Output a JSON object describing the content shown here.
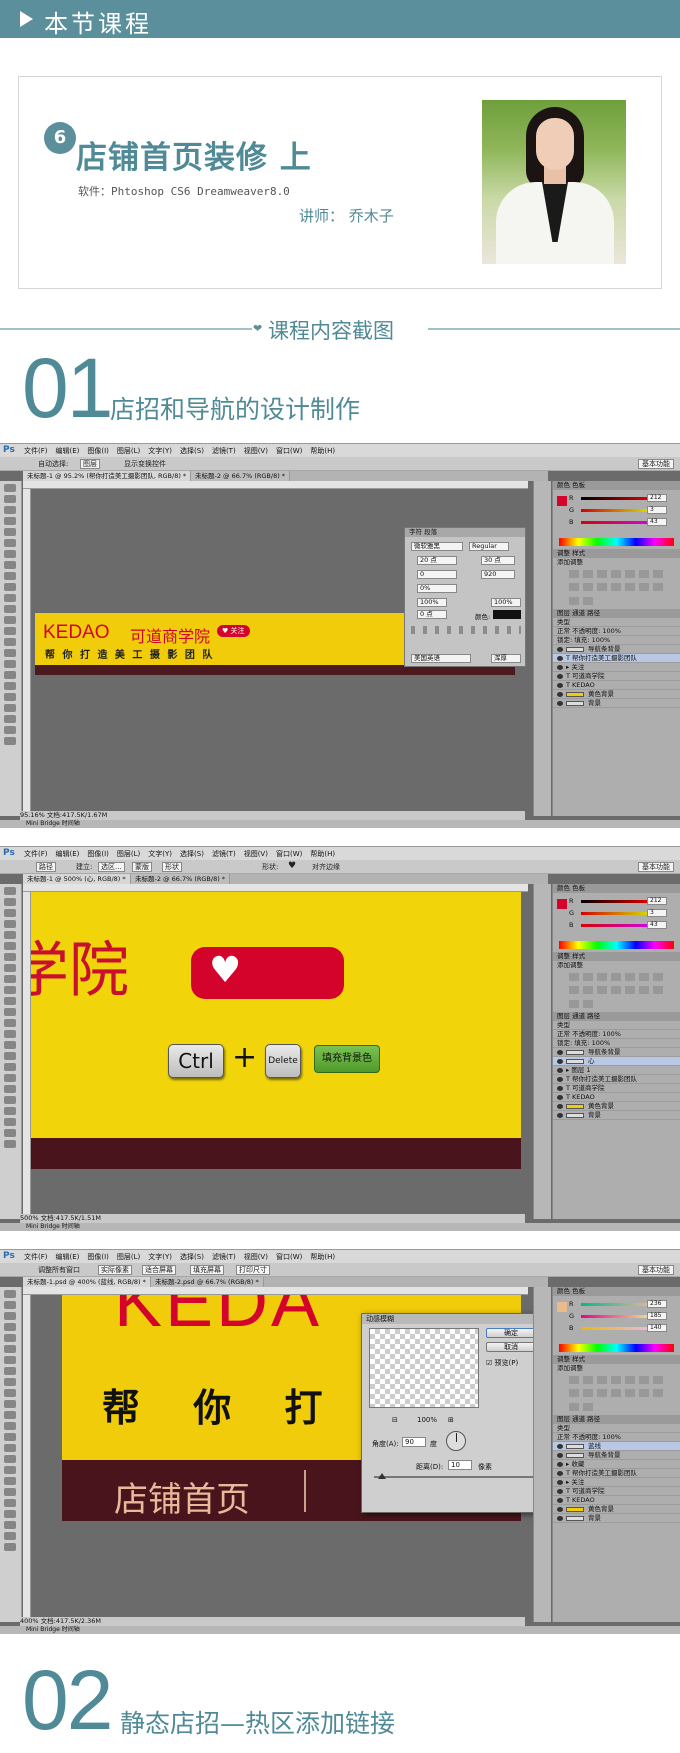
{
  "header": {
    "title": "本节课程"
  },
  "course": {
    "number": "6",
    "title": "店铺首页装修 上",
    "software": "软件：Phtoshop CS6 Dreamweaver8.0",
    "lecturer": "讲师：  乔木子"
  },
  "section_header": {
    "title": "课程内容截图"
  },
  "sections": [
    {
      "number": "01",
      "title": "店招和导航的设计制作"
    },
    {
      "number": "02",
      "title": "静态店招—热区添加链接"
    }
  ],
  "photoshop": {
    "logo": "Ps",
    "menu": [
      "文件(F)",
      "编辑(E)",
      "图像(I)",
      "图层(L)",
      "文字(Y)",
      "选择(S)",
      "滤镜(T)",
      "视图(V)",
      "窗口(W)",
      "帮助(H)"
    ],
    "workspace": "基本功能",
    "mini_bridge": "Mini Bridge",
    "timeline": "时间轴",
    "panel_tabs": {
      "color": "颜色",
      "swatches": "色板",
      "adjust": "调整",
      "styles": "样式",
      "layers": "图层",
      "channels": "通道",
      "paths": "路径"
    },
    "add_adjust": "添加调整",
    "rgb": [
      "R",
      "G",
      "B"
    ],
    "layer_kind": "类型",
    "blend": "正常",
    "opacity_label": "不透明度:",
    "fill_label": "填充:",
    "lock_label": "锁定:",
    "percent": "100%"
  },
  "shot1": {
    "options": {
      "auto_select": "自动选择:",
      "group": "图层",
      "show_transform": "显示变换控件"
    },
    "tabs": [
      "未标题-1 @ 95.2% (帮你打造美工摄影团队, RGB/8) *",
      "未标题-2 @ 66.7% (RGB/8) *"
    ],
    "zoom": "95.16%",
    "doc": "文档:417.5K/1.67M",
    "banner_brand": "KEDAO",
    "banner_cn": "可道商学院",
    "follow": "关注",
    "banner_sub": "帮 你 打 造 美 工 摄 影 团 队",
    "char_panel": {
      "tab1": "字符",
      "tab2": "段落",
      "font": "微软雅黑",
      "style": "Regular",
      "size": "20 点",
      "leading": "30 点",
      "tracking": "920",
      "kerning": "0",
      "scale_h": "100%",
      "scale_v": "100%",
      "shift": "0 点",
      "pct": "0%",
      "color_label": "颜色:",
      "lang": "美国英语",
      "aa": "浑厚"
    },
    "rgb_values": [
      "212",
      "3",
      "43"
    ],
    "layers": [
      "导航条背景",
      "帮你打造美工摄影团队",
      "关注",
      "可道商学院",
      "KEDAO",
      "黄色背景",
      "背景"
    ]
  },
  "shot2": {
    "options": {
      "path": "路径",
      "build": "建立:",
      "select": "选区...",
      "mask": "蒙版",
      "shape": "形状",
      "shape_label": "形状:",
      "align": "对齐边缘"
    },
    "tabs": [
      "未标题-1 @ 500% (心, RGB/8) *",
      "未标题-2 @ 66.7% (RGB/8) *"
    ],
    "zoom": "500%",
    "doc": "文档:417.5K/1.51M",
    "big_text": "学院",
    "ctrl": "Ctrl",
    "plus": "+",
    "delete": "Delete",
    "fill_tip": "填充背景色",
    "rgb_values": [
      "212",
      "3",
      "43"
    ],
    "layers": [
      "导航条背景",
      "心",
      "图层 1",
      "帮你打造美工摄影团队",
      "可道商学院",
      "KEDAO",
      "黄色背景",
      "背景"
    ]
  },
  "shot3": {
    "options": {
      "resize": "调整所有窗口",
      "actual": "实际像素",
      "fit": "适合屏幕",
      "fill": "填充屏幕",
      "print": "打印尺寸"
    },
    "tabs": [
      "未标题-1.psd @ 400% (蓝线, RGB/8) *",
      "未标题-2.psd @ 66.7% (RGB/8) *"
    ],
    "zoom": "400%",
    "doc": "文档:417.5K/2.36M",
    "text_kedao": "KEDA",
    "text_sub": "帮 你 打 造",
    "nav_text": "店铺首页",
    "dialog": {
      "title": "动感模糊",
      "ok": "确定",
      "cancel": "取消",
      "preview": "预览(P)",
      "zoom": "100%",
      "angle_label": "角度(A):",
      "angle": "90",
      "angle_unit": "度",
      "dist_label": "距离(D):",
      "dist": "10",
      "dist_unit": "像素"
    },
    "rgb_values": [
      "236",
      "185",
      "140"
    ],
    "layers": [
      "蓝线",
      "导航条背景",
      "收藏",
      "帮你打造美工摄影团队",
      "关注",
      "可道商学院",
      "KEDAO",
      "黄色背景",
      "背景"
    ]
  },
  "colors": {
    "teal": "#5c8f9c",
    "yellow": "#f1cc0a",
    "red": "#d4032b",
    "maroon": "#4a1a1e"
  }
}
